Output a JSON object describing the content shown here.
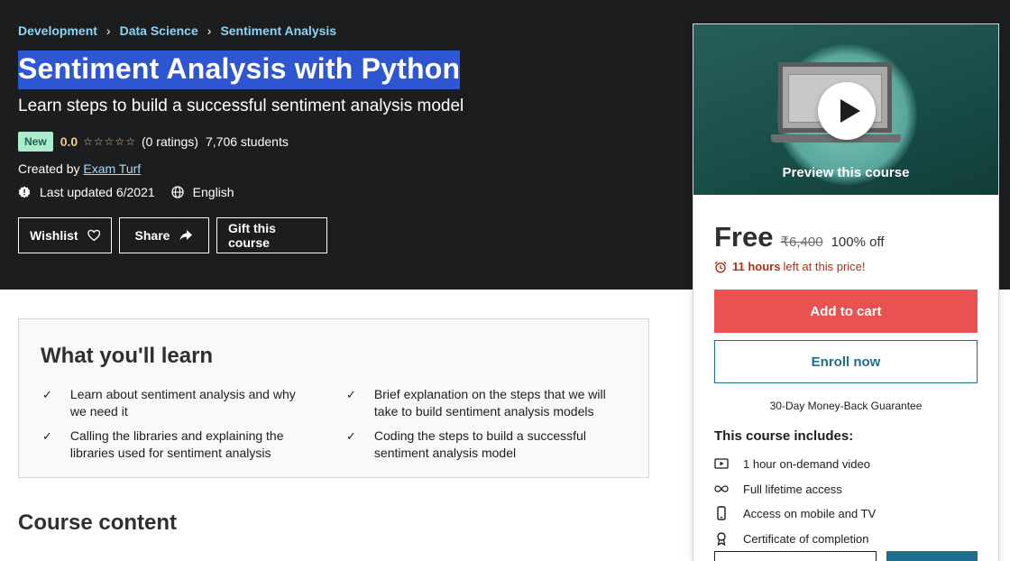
{
  "breadcrumb": {
    "items": [
      "Development",
      "Data Science",
      "Sentiment Analysis"
    ]
  },
  "course": {
    "title": "Sentiment Analysis with Python",
    "subtitle": "Learn steps to build a successful sentiment analysis model",
    "badge": "New",
    "rating": "0.0",
    "stars_filled": 0,
    "stars_total": 5,
    "ratings_count": "(0 ratings)",
    "students": "7,706 students",
    "created_by_label": "Created by",
    "author": "Exam Turf",
    "last_updated": "Last updated 6/2021",
    "language": "English"
  },
  "actions": {
    "wishlist": "Wishlist",
    "share": "Share",
    "gift": "Gift this course"
  },
  "learn": {
    "title": "What you'll learn",
    "items": [
      "Learn about sentiment analysis and why we need it",
      "Brief explanation on the steps that we will take to build sentiment analysis models",
      "Calling the libraries and explaining the libraries used for sentiment analysis",
      "Coding the steps to build a successful sentiment analysis model"
    ]
  },
  "course_content": {
    "title": "Course content"
  },
  "sidebar": {
    "preview_label": "Preview this course",
    "price": "Free",
    "original_price": "₹6,400",
    "discount": "100% off",
    "timer_hours": "11 hours",
    "timer_rest": "left at this price!",
    "add_to_cart": "Add to cart",
    "enroll": "Enroll now",
    "guarantee": "30-Day Money-Back Guarantee",
    "includes_title": "This course includes:",
    "includes": [
      {
        "icon": "video-icon",
        "label": "1 hour on-demand video"
      },
      {
        "icon": "infinity-icon",
        "label": "Full lifetime access"
      },
      {
        "icon": "mobile-icon",
        "label": "Access on mobile and TV"
      },
      {
        "icon": "certificate-icon",
        "label": "Certificate of completion"
      }
    ]
  },
  "colors": {
    "hero_bg": "#1c1d1f",
    "title_highlight": "#2d56d0",
    "cart_button": "#ea5252",
    "enroll_border": "#1e6f8c",
    "timer_text": "#b32d0f",
    "badge_bg": "#acebcb"
  }
}
